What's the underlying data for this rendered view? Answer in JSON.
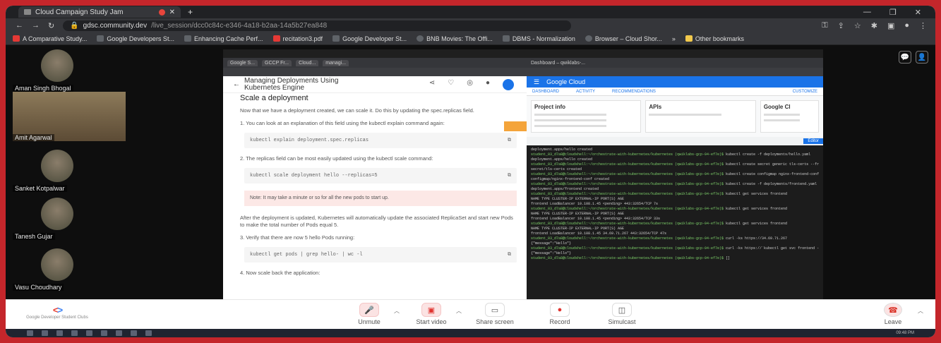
{
  "browser": {
    "tab_title": "Cloud Campaign Study Jam",
    "url_host": "gdsc.community.dev",
    "url_path": "/live_session/dcc0c84c-e346-4a18-b2aa-14a5b27ea848",
    "bookmarks": [
      "A Comparative Study...",
      "Google Developers St...",
      "Enhancing Cache Perf...",
      "recitation3.pdf",
      "Google Developer St...",
      "BNB Movies: The Offi...",
      "DBMS - Normalization",
      "Browser – Cloud Shor...",
      "Other bookmarks"
    ]
  },
  "participants": [
    {
      "name": "Aman Singh Bhogal",
      "video": false
    },
    {
      "name": "Amit Agarwal",
      "video": true
    },
    {
      "name": "Sanket Kotpalwar",
      "video": false
    },
    {
      "name": "Tanesh Gujar",
      "video": false
    },
    {
      "name": "Vasu Choudhary",
      "video": false
    }
  ],
  "doc": {
    "tabs": [
      "Google S...",
      "GCCP Fr...",
      "Cloud...",
      "managi..."
    ],
    "header_title": "Managing Deployments Using Kubernetes Engine",
    "section": "Scale a deployment",
    "intro": "Now that we have a deployment created, we can scale it. Do this by updating the spec.replicas field.",
    "step1": "1. You can look at an explanation of this field using the kubectl explain command again:",
    "code1": "kubectl explain deployment.spec.replicas",
    "step2": "2. The replicas field can be most easily updated using the kubectl scale command:",
    "code2": "kubectl scale deployment hello --replicas=5",
    "note": "Note: It may take a minute or so for all the new pods to start up.",
    "para": "After the deployment is updated, Kubernetes will automatically update the associated ReplicaSet and start new Pods to make the total number of Pods equal 5.",
    "step3": "3. Verify that there are now 5 hello Pods running:",
    "code3": "kubectl get pods | grep hello- | wc -l",
    "step4": "4. Now scale back the application:"
  },
  "console": {
    "tab": "Dashboard – qwiklabs-...",
    "brand": "Google Cloud",
    "sub_tabs": [
      "DASHBOARD",
      "ACTIVITY",
      "RECOMMENDATIONS"
    ],
    "customize": "CUSTOMIZE",
    "cards": [
      "Project info",
      "APIs",
      "Google Cl"
    ],
    "terminal_btn": "Editor",
    "terminal_lines": [
      "deployment.apps/hello created",
      "student_03_d7a8@cloudshell:~/orchestrate-with-kubernetes/kubernetes (qwiklabs-gcp-04-ef7e)$ kubectl create -f deployments/hello.yaml",
      "deployment.apps/hello created",
      "student_03_d7a8@cloudshell:~/orchestrate-with-kubernetes/kubernetes (qwiklabs-gcp-04-ef7e)$ kubectl create secret generic tls-certs --from-file tls/",
      "secret/tls-certs created",
      "student_03_d7a8@cloudshell:~/orchestrate-with-kubernetes/kubernetes (qwiklabs-gcp-04-ef7e)$ kubectl create configmap nginx-frontend-conf --from-file=nginx/frontend.conf",
      "configmap/nginx-frontend-conf created",
      "student_03_d7a8@cloudshell:~/orchestrate-with-kubernetes/kubernetes (qwiklabs-gcp-04-ef7e)$ kubectl create -f deployments/frontend.yaml",
      "deployment.apps/frontend created",
      "student_03_d7a8@cloudshell:~/orchestrate-with-kubernetes/kubernetes (qwiklabs-gcp-04-ef7e)$ kubectl get services frontend",
      "NAME       TYPE           CLUSTER-IP    EXTERNAL-IP   PORT(S)         AGE",
      "frontend   LoadBalancer   10.108.1.45   <pending>     443:32654/TCP   7s",
      "student_03_d7a8@cloudshell:~/orchestrate-with-kubernetes/kubernetes (qwiklabs-gcp-04-ef7e)$ kubectl get services frontend",
      "NAME       TYPE           CLUSTER-IP    EXTERNAL-IP   PORT(S)         AGE",
      "frontend   LoadBalancer   10.108.1.45   <pending>     443:32654/TCP   33s",
      "student_03_d7a8@cloudshell:~/orchestrate-with-kubernetes/kubernetes (qwiklabs-gcp-04-ef7e)$ kubectl get services frontend",
      "NAME       TYPE           CLUSTER-IP    EXTERNAL-IP    PORT(S)         AGE",
      "frontend   LoadBalancer   10.108.1.45   34.69.71.267   443:32654/TCP   47s",
      "student_03_d7a8@cloudshell:~/orchestrate-with-kubernetes/kubernetes (qwiklabs-gcp-04-ef7e)$ curl -ks https://34.69.71.267",
      "{\"message\":\"Hello\"}",
      "student_03_d7a8@cloudshell:~/orchestrate-with-kubernetes/kubernetes (qwiklabs-gcp-04-ef7e)$ curl -ks https://`kubectl get svc frontend -o=jsonpath=\"{.status.loadBalancer.ingress[0].ip}\"`",
      "{\"message\":\"Hello\"}",
      "student_03_d7a8@cloudshell:~/orchestrate-with-kubernetes/kubernetes (qwiklabs-gcp-04-ef7e)$ []"
    ]
  },
  "toolbar": {
    "org": "Google Developer Student Clubs",
    "unmute": "Unmute",
    "start_video": "Start video",
    "share_screen": "Share screen",
    "record": "Record",
    "simulcast": "Simulcast",
    "leave": "Leave"
  },
  "taskbar": {
    "clock": "09:48 PM"
  }
}
